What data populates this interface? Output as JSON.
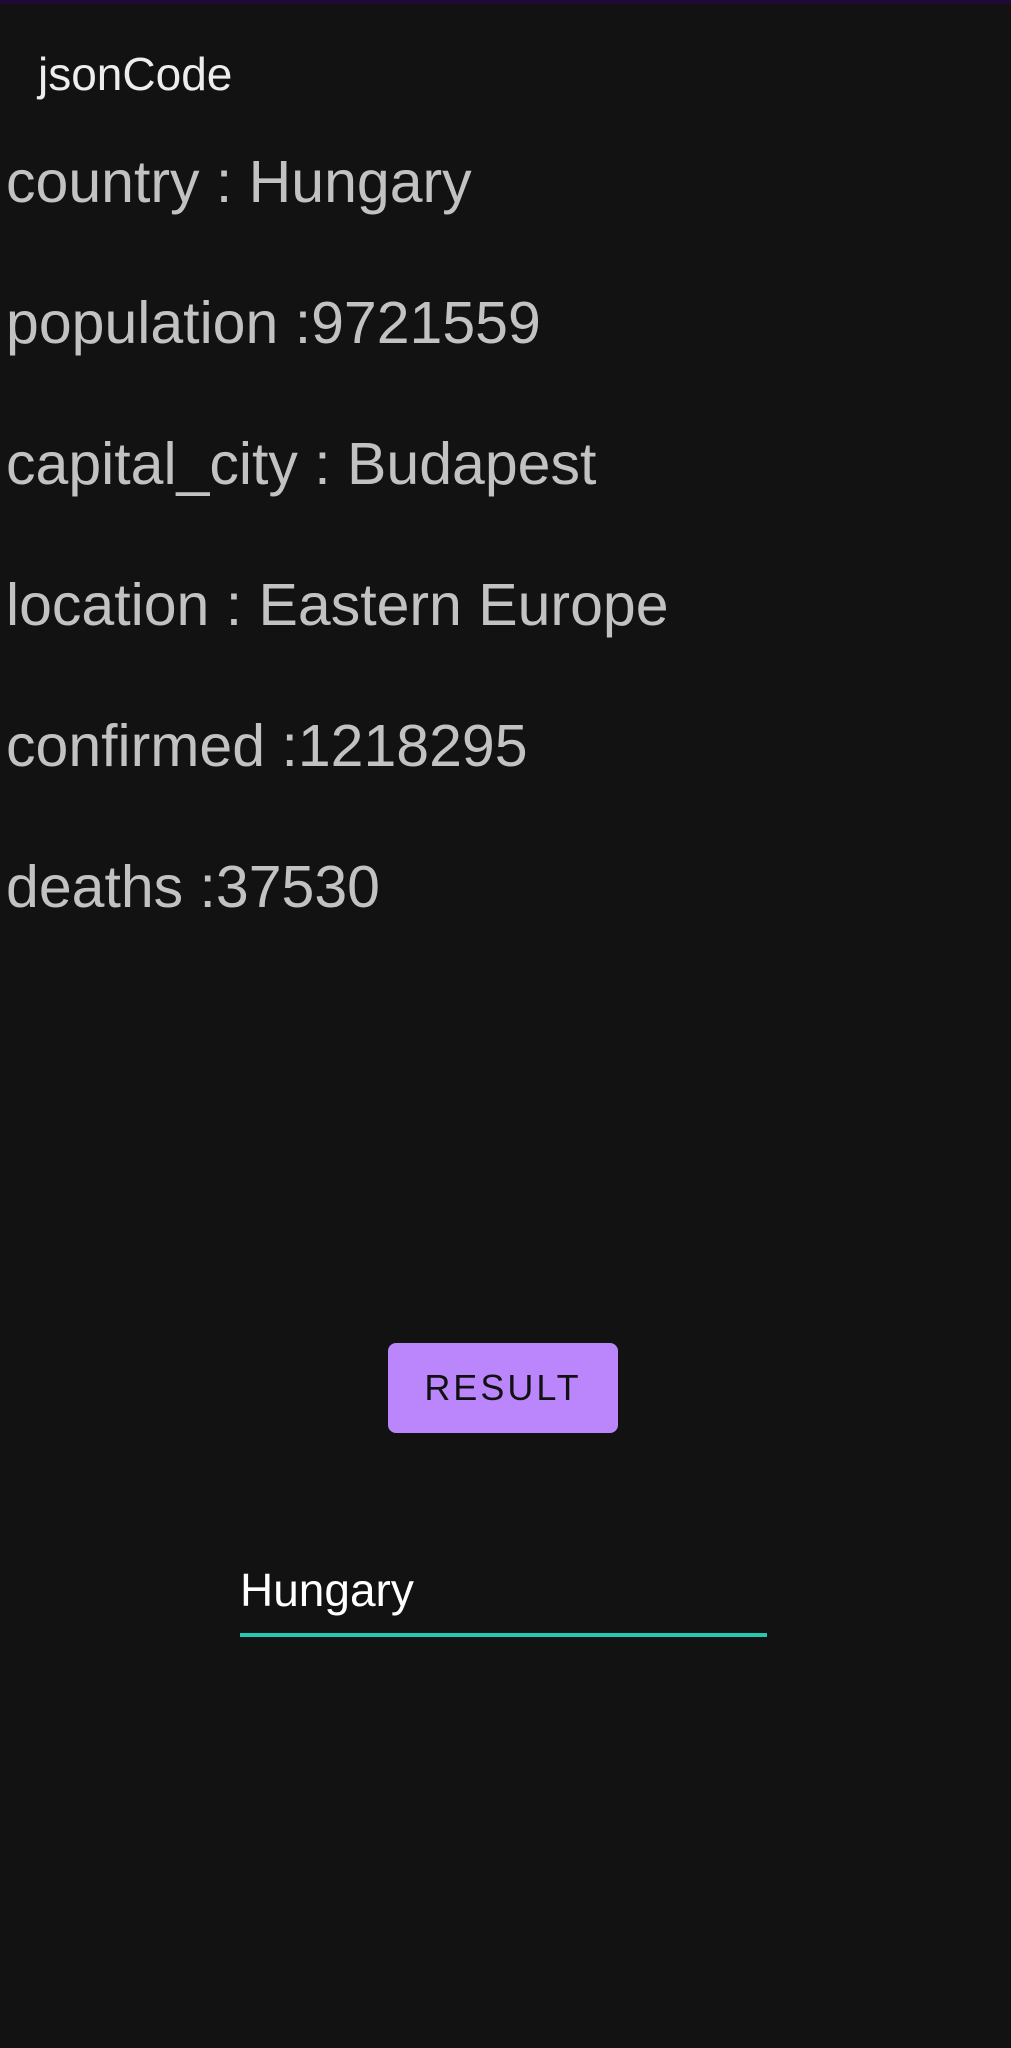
{
  "app": {
    "title": "jsonCode"
  },
  "info": {
    "rows": [
      "country : Hungary",
      "population :9721559",
      "capital_city : Budapest",
      "location : Eastern Europe",
      "confirmed :1218295",
      "deaths :37530"
    ]
  },
  "actions": {
    "result_label": "RESULT"
  },
  "input": {
    "value": "Hungary"
  },
  "colors": {
    "background": "#121212",
    "accent": "#bb86fc",
    "input_underline": "#26c6b0"
  }
}
